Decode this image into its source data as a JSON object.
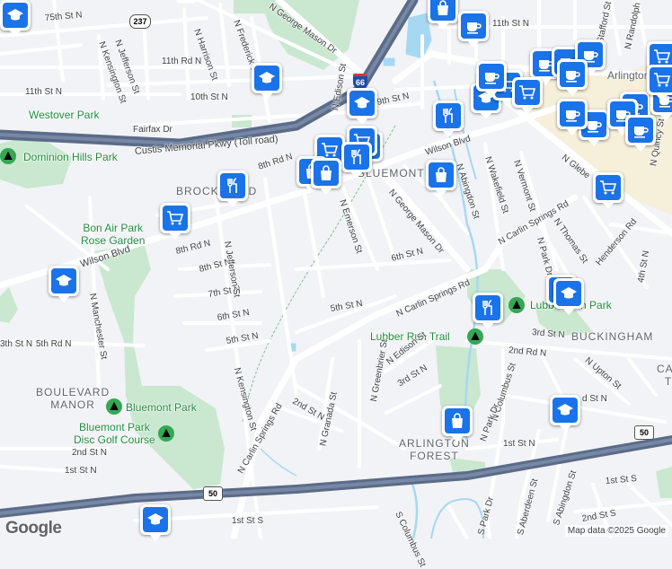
{
  "map": {
    "provider_logo": "Google",
    "attribution": "Map data ©2025 Google",
    "colors": {
      "background": "#f2f3f6",
      "park": "#c9e8cf",
      "highway": "#5b6b87",
      "water": "#a6d8f2",
      "road": "#ffffff",
      "pin": "#1a73e8"
    }
  },
  "area_labels": [
    "BROCKWOOD",
    "BLUEMONT",
    "BUCKINGHAM",
    "BOULEVARD\nMANOR",
    "ARLINGTON\nFOREST",
    "Cath\nTh"
  ],
  "park_labels": [
    "Westover Park",
    "Dominion Hills Park",
    "Bon Air Park\nRose Garden",
    "Bluemont Park",
    "Bluemont Park\nDisc Golf Course",
    "Lubber Run Park",
    "Lubber Run Trail",
    "Arlington-M"
  ],
  "highway_labels": [
    "Custis Memorial Pkwy (Toll road)"
  ],
  "shields": [
    "237",
    "66",
    "50",
    "50"
  ],
  "street_labels": [
    "75th St N",
    "N George Mason Dr",
    "11th St N",
    "11th Rd N",
    "N Jefferson St",
    "N Kensington St",
    "N Harrison St",
    "N Frederick St",
    "10th St N",
    "11th St N",
    "Fairfax Dr",
    "9th St N",
    "8th Rd N",
    "Wilson Blvd",
    "N Edison St",
    "N Abingdon St",
    "N Wakefield St",
    "N Vermont St",
    "N Glebe",
    "N Quincy St",
    "N Carlin Springs Rd",
    "N Thomas St",
    "Henderson Rd",
    "4th St N",
    "N Park Dr",
    "N Emerson St",
    "N George Mason Dr",
    "6th St N",
    "8th Rd N",
    "8th St N",
    "7th St N",
    "6th St N",
    "5th St N",
    "Wilson Blvd",
    "N Manchester St",
    "N Jefferson St",
    "5th St N",
    "N Carlin Springs Rd",
    "3rd St N",
    "2nd Rd N",
    "N Upton St",
    "5th Rd N",
    "3th St N",
    "N Edison St",
    "3rd St N",
    "N Greenbrier St",
    "N Columbus St",
    "N Kensington St",
    "N Carlin Springs Rd",
    "2nd St N",
    "N Granada St",
    "N Park Dr",
    "2nd St N",
    "1st St N",
    "1st St N",
    "1st St S",
    "1st St S",
    "S Columbus St",
    "S Park Dr",
    "S Aberdeen St",
    "S Abingdon St",
    "2nd St S",
    "N Randolph St",
    "Stafford St",
    "d St N"
  ],
  "pins": [
    {
      "icon": "shopping-bag"
    },
    {
      "icon": "cafe"
    },
    {
      "icon": "school"
    },
    {
      "icon": "school"
    },
    {
      "icon": "grocery"
    },
    {
      "icon": "restaurant"
    },
    {
      "icon": "shopping-bag"
    },
    {
      "icon": "grocery"
    },
    {
      "icon": "restaurant"
    },
    {
      "icon": "restaurant"
    },
    {
      "icon": "shopping-bag"
    },
    {
      "icon": "grocery"
    },
    {
      "icon": "school"
    },
    {
      "icon": "restaurant"
    },
    {
      "icon": "shopping-bag"
    },
    {
      "icon": "grocery"
    },
    {
      "icon": "school"
    },
    {
      "icon": "restaurant"
    },
    {
      "icon": "school"
    },
    {
      "icon": "shopping-bag"
    },
    {
      "icon": "school"
    },
    {
      "icon": "school"
    },
    {
      "icon": "grocery"
    },
    {
      "icon": "cafe"
    },
    {
      "icon": "cafe"
    },
    {
      "icon": "cafe"
    },
    {
      "icon": "cafe"
    },
    {
      "icon": "cafe"
    },
    {
      "icon": "cafe"
    },
    {
      "icon": "cafe"
    },
    {
      "icon": "grocery"
    },
    {
      "icon": "grocery"
    },
    {
      "icon": "cafe"
    },
    {
      "icon": "school"
    },
    {
      "icon": "cafe"
    },
    {
      "icon": "grocery"
    },
    {
      "icon": "cafe"
    },
    {
      "icon": "cafe"
    },
    {
      "icon": "school"
    }
  ]
}
